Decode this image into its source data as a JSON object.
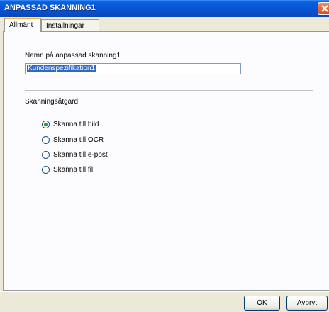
{
  "window": {
    "title": "ANPASSAD SKANNING1"
  },
  "tabs": [
    {
      "label": "Allmänt",
      "active": true
    },
    {
      "label": "Inställningar",
      "active": false
    }
  ],
  "general": {
    "name_label": "Namn på anpassad skanning1",
    "name_value": "Kundenspezifikation1",
    "action_label": "Skanningsåtgärd",
    "options": [
      {
        "label": "Skanna till bild",
        "selected": true
      },
      {
        "label": "Skanna till OCR",
        "selected": false
      },
      {
        "label": "Skanna till e-post",
        "selected": false
      },
      {
        "label": "Skanna till fil",
        "selected": false
      }
    ]
  },
  "buttons": {
    "ok": "OK",
    "cancel": "Avbryt"
  },
  "colors": {
    "titlebar": "#0754d4",
    "selection": "#316ac5",
    "radio_dot": "#21a121"
  }
}
